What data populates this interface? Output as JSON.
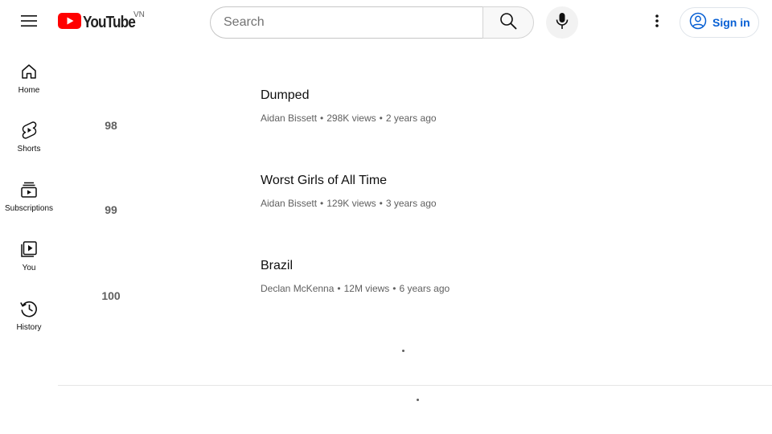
{
  "masthead": {
    "menu_icon": "hamburger-menu-icon",
    "logo_text": "YouTube",
    "country_code": "VN",
    "search": {
      "placeholder": "Search",
      "value": ""
    },
    "search_icon": "search-icon",
    "mic_icon": "microphone-icon",
    "more_icon": "more-vertical-icon",
    "signin_label": "Sign in",
    "brand_red": "#ff0000",
    "link_blue": "#065fd4"
  },
  "guide": {
    "items": [
      {
        "label": "Home",
        "icon": "home-icon"
      },
      {
        "label": "Shorts",
        "icon": "shorts-icon"
      },
      {
        "label": "Subscriptions",
        "icon": "subscriptions-icon"
      },
      {
        "label": "You",
        "icon": "you-library-icon"
      },
      {
        "label": "History",
        "icon": "history-icon"
      }
    ]
  },
  "videos": [
    {
      "rank": "98",
      "title": "Dumped",
      "channel": "Aidan Bissett",
      "views": "298K views",
      "age": "2 years ago"
    },
    {
      "rank": "99",
      "title": "Worst Girls of All Time",
      "channel": "Aidan Bissett",
      "views": "129K views",
      "age": "3 years ago"
    },
    {
      "rank": "100",
      "title": "Brazil",
      "channel": "Declan McKenna",
      "views": "12M views",
      "age": "6 years ago"
    }
  ],
  "separator": "•"
}
